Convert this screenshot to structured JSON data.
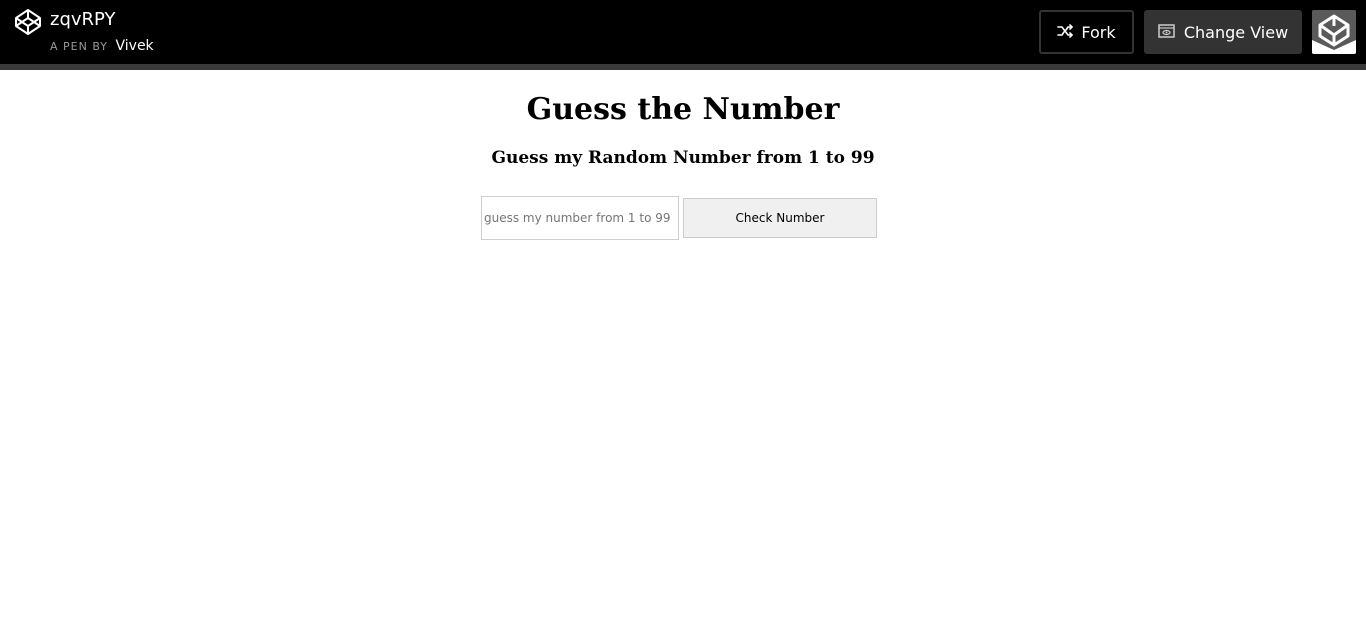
{
  "header": {
    "pen_title": "zqvRPY",
    "pen_by_label": "A PEN BY",
    "author": "Vivek",
    "fork_label": "Fork",
    "change_view_label": "Change View",
    "logo_icon": "codepen-logo-icon",
    "avatar_icon": "codepen-avatar-icon"
  },
  "main": {
    "title": "Guess the Number",
    "subtitle": "Guess my Random Number from 1 to 99",
    "input": {
      "value": "",
      "placeholder": "guess my number from 1 to 99"
    },
    "check_button_label": "Check Number"
  },
  "colors": {
    "topbar_bg": "#000000",
    "topbar_border": "#3a3a3a",
    "change_view_bg": "#333333",
    "button_bg": "#f0f0f0"
  }
}
